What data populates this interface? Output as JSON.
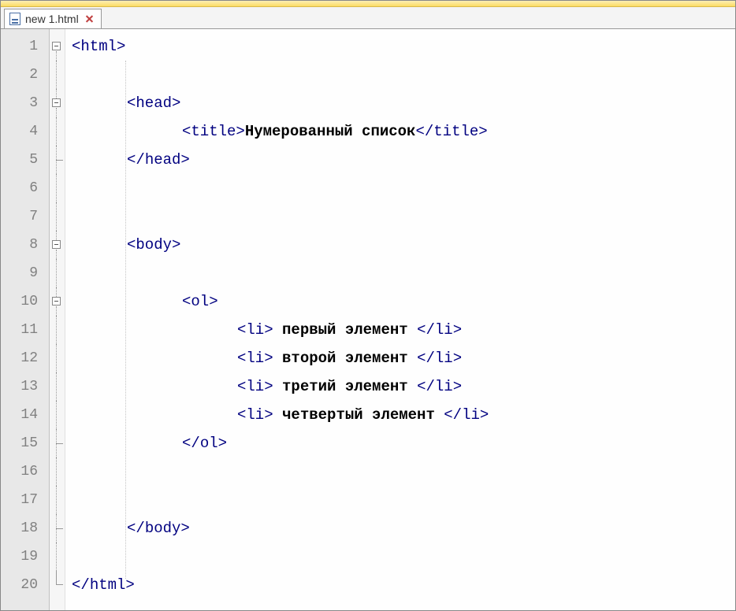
{
  "tab": {
    "filename": "new  1.html"
  },
  "colors": {
    "tag": "#000080",
    "bracket": "#0000c8",
    "text": "#000000"
  },
  "lines": [
    {
      "n": 1,
      "indent": 0,
      "fold": "box",
      "tokens": [
        [
          "<",
          "b"
        ],
        [
          "html",
          "t"
        ],
        [
          ">",
          "b"
        ]
      ]
    },
    {
      "n": 2,
      "indent": 0,
      "fold": "line",
      "tokens": []
    },
    {
      "n": 3,
      "indent": 1,
      "fold": "box",
      "tokens": [
        [
          "<",
          "b"
        ],
        [
          "head",
          "t"
        ],
        [
          ">",
          "b"
        ]
      ]
    },
    {
      "n": 4,
      "indent": 2,
      "fold": "line",
      "tokens": [
        [
          "<",
          "b"
        ],
        [
          "title",
          "t"
        ],
        [
          ">",
          "b"
        ],
        [
          "Нумерованный список",
          "x"
        ],
        [
          "</",
          "b"
        ],
        [
          "title",
          "t"
        ],
        [
          ">",
          "b"
        ]
      ]
    },
    {
      "n": 5,
      "indent": 1,
      "fold": "tee",
      "tokens": [
        [
          "</",
          "b"
        ],
        [
          "head",
          "t"
        ],
        [
          ">",
          "b"
        ]
      ]
    },
    {
      "n": 6,
      "indent": 0,
      "fold": "line",
      "tokens": []
    },
    {
      "n": 7,
      "indent": 0,
      "fold": "line",
      "tokens": []
    },
    {
      "n": 8,
      "indent": 1,
      "fold": "box",
      "tokens": [
        [
          "<",
          "b"
        ],
        [
          "body",
          "t"
        ],
        [
          ">",
          "b"
        ]
      ]
    },
    {
      "n": 9,
      "indent": 0,
      "fold": "line",
      "tokens": []
    },
    {
      "n": 10,
      "indent": 2,
      "fold": "box",
      "tokens": [
        [
          "<",
          "b"
        ],
        [
          "ol",
          "t"
        ],
        [
          ">",
          "b"
        ]
      ]
    },
    {
      "n": 11,
      "indent": 3,
      "fold": "line",
      "tokens": [
        [
          "<",
          "b"
        ],
        [
          "li",
          "t"
        ],
        [
          ">",
          "b"
        ],
        [
          " первый элемент ",
          "x"
        ],
        [
          "</",
          "b"
        ],
        [
          "li",
          "t"
        ],
        [
          ">",
          "b"
        ]
      ]
    },
    {
      "n": 12,
      "indent": 3,
      "fold": "line",
      "tokens": [
        [
          "<",
          "b"
        ],
        [
          "li",
          "t"
        ],
        [
          ">",
          "b"
        ],
        [
          " второй элемент ",
          "x"
        ],
        [
          "</",
          "b"
        ],
        [
          "li",
          "t"
        ],
        [
          ">",
          "b"
        ]
      ]
    },
    {
      "n": 13,
      "indent": 3,
      "fold": "line",
      "tokens": [
        [
          "<",
          "b"
        ],
        [
          "li",
          "t"
        ],
        [
          ">",
          "b"
        ],
        [
          " третий элемент ",
          "x"
        ],
        [
          "</",
          "b"
        ],
        [
          "li",
          "t"
        ],
        [
          ">",
          "b"
        ]
      ]
    },
    {
      "n": 14,
      "indent": 3,
      "fold": "line",
      "tokens": [
        [
          "<",
          "b"
        ],
        [
          "li",
          "t"
        ],
        [
          ">",
          "b"
        ],
        [
          " четвертый элемент ",
          "x"
        ],
        [
          "</",
          "b"
        ],
        [
          "li",
          "t"
        ],
        [
          ">",
          "b"
        ]
      ]
    },
    {
      "n": 15,
      "indent": 2,
      "fold": "tee",
      "tokens": [
        [
          "</",
          "b"
        ],
        [
          "ol",
          "t"
        ],
        [
          ">",
          "b"
        ]
      ]
    },
    {
      "n": 16,
      "indent": 0,
      "fold": "line",
      "tokens": []
    },
    {
      "n": 17,
      "indent": 0,
      "fold": "line",
      "tokens": []
    },
    {
      "n": 18,
      "indent": 1,
      "fold": "tee",
      "tokens": [
        [
          "</",
          "b"
        ],
        [
          "body",
          "t"
        ],
        [
          ">",
          "b"
        ]
      ]
    },
    {
      "n": 19,
      "indent": 0,
      "fold": "line",
      "tokens": []
    },
    {
      "n": 20,
      "indent": 0,
      "fold": "end",
      "tokens": [
        [
          "</",
          "b"
        ],
        [
          "html",
          "t"
        ],
        [
          ">",
          "b"
        ]
      ]
    }
  ]
}
